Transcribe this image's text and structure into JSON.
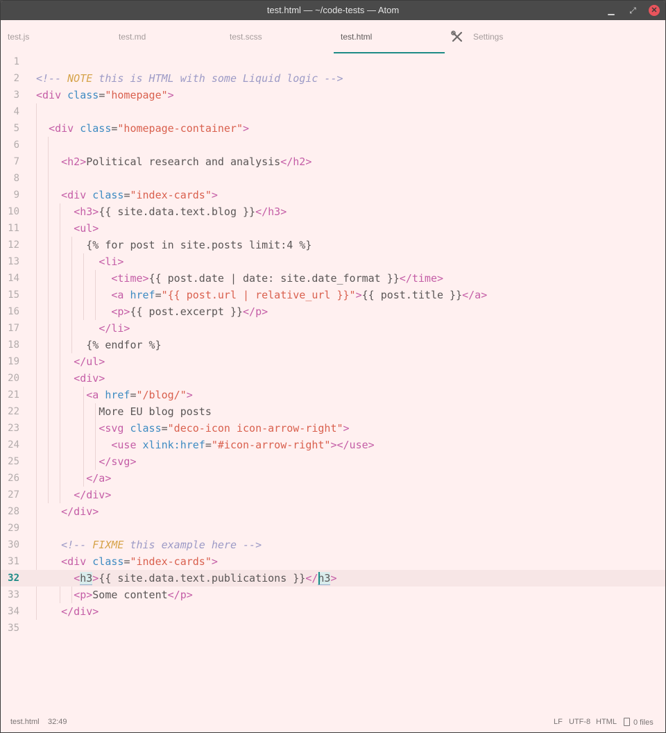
{
  "window": {
    "title": "test.html — ~/code-tests — Atom",
    "min_icon": "minimize-icon",
    "max_icon": "maximize-icon",
    "close_icon": "close-icon"
  },
  "tabs": [
    {
      "label": "test.js",
      "active": false
    },
    {
      "label": "test.md",
      "active": false
    },
    {
      "label": "test.scss",
      "active": false
    },
    {
      "label": "test.html",
      "active": true
    },
    {
      "label": "Settings",
      "active": false,
      "icon": "tools-icon"
    }
  ],
  "editor": {
    "language": "HTML",
    "current_line": 32,
    "lines": [
      [],
      [
        [
          "cm",
          "<!-- "
        ],
        [
          "kw",
          "NOTE"
        ],
        [
          "cm",
          " this is HTML with some Liquid logic -->"
        ]
      ],
      [
        [
          "t",
          "<div "
        ],
        [
          "a",
          "class"
        ],
        [
          "",
          "="
        ],
        [
          "s",
          "\"homepage\""
        ],
        [
          "t",
          ">"
        ]
      ],
      [],
      [
        [
          "",
          "  "
        ],
        [
          "t",
          "<div "
        ],
        [
          "a",
          "class"
        ],
        [
          "",
          "="
        ],
        [
          "s",
          "\"homepage-container\""
        ],
        [
          "t",
          ">"
        ]
      ],
      [],
      [
        [
          "",
          "    "
        ],
        [
          "t",
          "<h2>"
        ],
        [
          "",
          "Political research and analysis"
        ],
        [
          "t",
          "</h2>"
        ]
      ],
      [],
      [
        [
          "",
          "    "
        ],
        [
          "t",
          "<div "
        ],
        [
          "a",
          "class"
        ],
        [
          "",
          "="
        ],
        [
          "s",
          "\"index-cards\""
        ],
        [
          "t",
          ">"
        ]
      ],
      [
        [
          "",
          "      "
        ],
        [
          "t",
          "<h3>"
        ],
        [
          "",
          "{{ site.data.text.blog }}"
        ],
        [
          "t",
          "</h3>"
        ]
      ],
      [
        [
          "",
          "      "
        ],
        [
          "t",
          "<ul>"
        ]
      ],
      [
        [
          "",
          "        {% for post in site.posts limit:4 %}"
        ]
      ],
      [
        [
          "",
          "          "
        ],
        [
          "t",
          "<li>"
        ]
      ],
      [
        [
          "",
          "            "
        ],
        [
          "t",
          "<time>"
        ],
        [
          "",
          "{{ post.date | date: site.date_format }}"
        ],
        [
          "t",
          "</time>"
        ]
      ],
      [
        [
          "",
          "            "
        ],
        [
          "t",
          "<a "
        ],
        [
          "a",
          "href"
        ],
        [
          "",
          "="
        ],
        [
          "s",
          "\"{{ post.url | relative_url }}\""
        ],
        [
          "t",
          ">"
        ],
        [
          "",
          "{{ post.title }}"
        ],
        [
          "t",
          "</a>"
        ]
      ],
      [
        [
          "",
          "            "
        ],
        [
          "t",
          "<p>"
        ],
        [
          "",
          "{{ post.excerpt }}"
        ],
        [
          "t",
          "</p>"
        ]
      ],
      [
        [
          "",
          "          "
        ],
        [
          "t",
          "</li>"
        ]
      ],
      [
        [
          "",
          "        {% endfor %}"
        ]
      ],
      [
        [
          "",
          "      "
        ],
        [
          "t",
          "</ul>"
        ]
      ],
      [
        [
          "",
          "      "
        ],
        [
          "t",
          "<div>"
        ]
      ],
      [
        [
          "",
          "        "
        ],
        [
          "t",
          "<a "
        ],
        [
          "a",
          "href"
        ],
        [
          "",
          "="
        ],
        [
          "s",
          "\"/blog/\""
        ],
        [
          "t",
          ">"
        ]
      ],
      [
        [
          "",
          "          More EU blog posts"
        ]
      ],
      [
        [
          "",
          "          "
        ],
        [
          "t",
          "<svg "
        ],
        [
          "a",
          "class"
        ],
        [
          "",
          "="
        ],
        [
          "s",
          "\"deco-icon icon-arrow-right\""
        ],
        [
          "t",
          ">"
        ]
      ],
      [
        [
          "",
          "            "
        ],
        [
          "t",
          "<use "
        ],
        [
          "a",
          "xlink:href"
        ],
        [
          "",
          "="
        ],
        [
          "s",
          "\"#icon-arrow-right\""
        ],
        [
          "t",
          "></use>"
        ]
      ],
      [
        [
          "",
          "          "
        ],
        [
          "t",
          "</svg>"
        ]
      ],
      [
        [
          "",
          "        "
        ],
        [
          "t",
          "</a>"
        ]
      ],
      [
        [
          "",
          "      "
        ],
        [
          "t",
          "</div>"
        ]
      ],
      [
        [
          "",
          "    "
        ],
        [
          "t",
          "</div>"
        ]
      ],
      [],
      [
        [
          "",
          "    "
        ],
        [
          "cm",
          "<!-- "
        ],
        [
          "kw",
          "FIXME"
        ],
        [
          "cm",
          " this example here -->"
        ]
      ],
      [
        [
          "",
          "    "
        ],
        [
          "t",
          "<div "
        ],
        [
          "a",
          "class"
        ],
        [
          "",
          "="
        ],
        [
          "s",
          "\"index-cards\""
        ],
        [
          "t",
          ">"
        ]
      ],
      [
        [
          "",
          "      "
        ],
        [
          "t",
          "<"
        ],
        [
          "hl",
          "h3"
        ],
        [
          "t",
          ">"
        ],
        [
          "",
          "{{ site.data.text.publications }}"
        ],
        [
          "t",
          "</"
        ],
        [
          "hl",
          "h3"
        ],
        [
          "t",
          ">"
        ]
      ],
      [
        [
          "",
          "      "
        ],
        [
          "t",
          "<p>"
        ],
        [
          "",
          "Some content"
        ],
        [
          "t",
          "</p>"
        ]
      ],
      [
        [
          "",
          "    "
        ],
        [
          "t",
          "</div>"
        ]
      ],
      []
    ]
  },
  "status": {
    "file": "test.html",
    "cursor_pos": "32:49",
    "line_ending": "LF",
    "encoding": "UTF-8",
    "grammar": "HTML",
    "files_icon": "file-icon",
    "files": "0 files"
  }
}
